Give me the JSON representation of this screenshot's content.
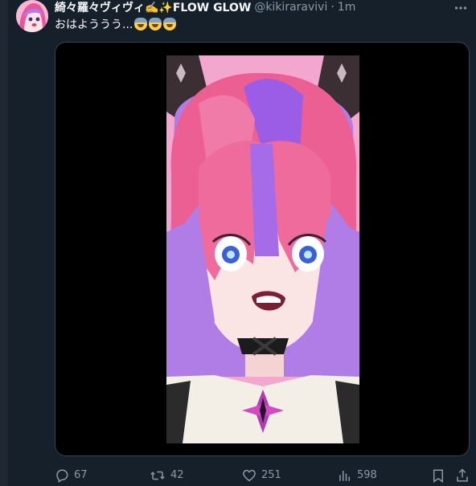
{
  "tweet": {
    "display_name": "綺々羅々ヴィヴィ✍️✨FLOW GLOW",
    "handle": "@kikiraravivi",
    "separator": "·",
    "time": "1m",
    "text": "おはよううう...",
    "emoji_count": 3,
    "emoji_name": "anguished-face-emoji"
  },
  "actions": {
    "replies": "67",
    "retweets": "42",
    "likes": "251",
    "views": "598"
  },
  "icons": {
    "more": "more-icon",
    "reply": "reply-icon",
    "retweet": "retweet-icon",
    "like": "heart-icon",
    "views": "views-icon",
    "bookmark": "bookmark-icon",
    "share": "share-icon"
  },
  "colors": {
    "background": "#15202b",
    "text_primary": "#f7f9f9",
    "text_secondary": "#8b98a5",
    "media_bg": "#000000",
    "media_border": "#38444d"
  }
}
